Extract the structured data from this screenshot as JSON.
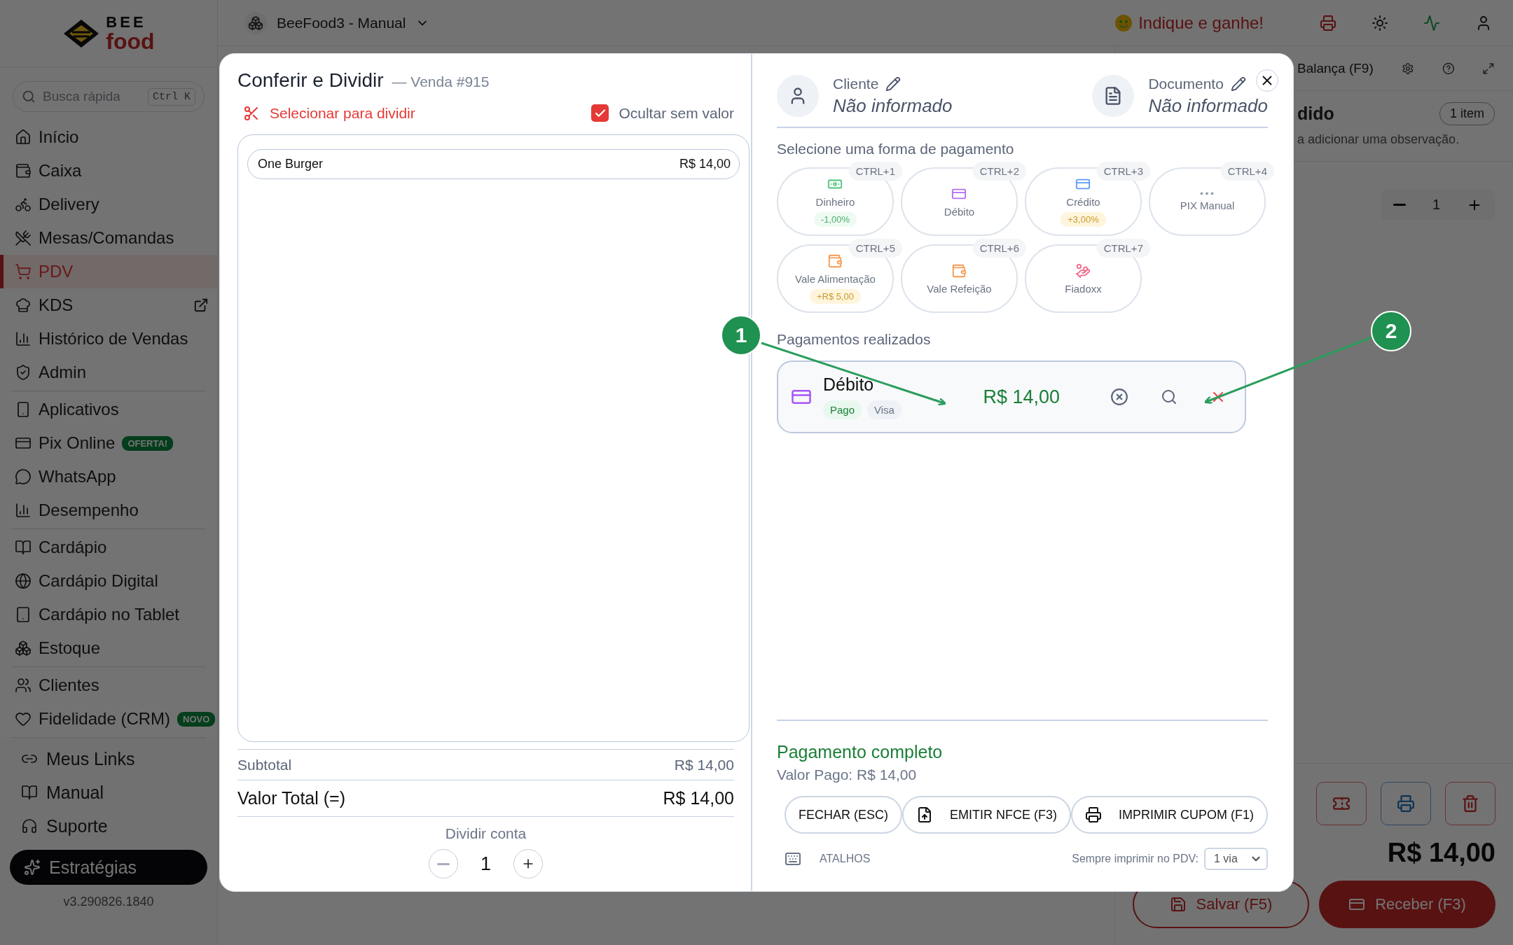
{
  "sidebar": {
    "logo": {
      "top": "BEE",
      "bottom": "food"
    },
    "search": {
      "placeholder": "Busca rápida",
      "shortcut": "Ctrl K"
    },
    "nav_groups": [
      [
        {
          "label": "Início",
          "selected": false
        },
        {
          "label": "Caixa",
          "selected": false
        },
        {
          "label": "Delivery",
          "selected": false
        },
        {
          "label": "Mesas/Comandas",
          "selected": false
        },
        {
          "label": "PDV",
          "selected": true
        },
        {
          "label": "KDS",
          "selected": false,
          "external": true
        },
        {
          "label": "Histórico de Vendas",
          "selected": false
        },
        {
          "label": "Admin",
          "selected": false
        }
      ],
      [
        {
          "label": "Aplicativos",
          "selected": false
        },
        {
          "label": "Pix Online",
          "selected": false,
          "badge": "OFERTA!"
        },
        {
          "label": "WhatsApp",
          "selected": false
        },
        {
          "label": "Desempenho",
          "selected": false
        }
      ],
      [
        {
          "label": "Cardápio",
          "selected": false
        },
        {
          "label": "Cardápio Digital",
          "selected": false
        },
        {
          "label": "Cardápio no Tablet",
          "selected": false
        },
        {
          "label": "Estoque",
          "selected": false
        }
      ],
      [
        {
          "label": "Clientes",
          "selected": false
        },
        {
          "label": "Fidelidade (CRM)",
          "selected": false,
          "badge": "NOVO"
        }
      ]
    ],
    "footer_items": [
      "Meus Links",
      "Manual",
      "Suporte"
    ],
    "cta": "Estratégias",
    "version": "v3.290826.1840"
  },
  "topbar": {
    "store": "BeeFood3 - Manual",
    "referral": "Indique e ganhe!"
  },
  "order_panel": {
    "scale_button": "Balança (F9)",
    "title": "dido",
    "item_count": "1 item",
    "note_hint": "a adicionar uma observação.",
    "quantity": "1",
    "total": "R$ 14,00",
    "save_button": "Salvar (F5)",
    "receive_button": "Receber (F3)"
  },
  "modal": {
    "title": "Conferir e Dividir",
    "subtitle": "— Venda #915",
    "split_select": "Selecionar para dividir",
    "hide_empty": {
      "label": "Ocultar sem valor",
      "checked": true
    },
    "items": [
      {
        "name": "One Burger",
        "price": "R$ 14,00"
      }
    ],
    "subtotal": {
      "label": "Subtotal",
      "value": "R$ 14,00"
    },
    "total": {
      "label": "Valor Total (=)",
      "value": "R$ 14,00"
    },
    "split": {
      "label": "Dividir conta",
      "count": "1"
    },
    "customer": {
      "label": "Cliente",
      "value": "Não informado"
    },
    "document": {
      "label": "Documento",
      "value": "Não informado"
    },
    "methods_title": "Selecione uma forma de pagamento",
    "methods": [
      {
        "label": "Dinheiro",
        "shortcut": "CTRL+1",
        "color": "#4cc47a",
        "adjustment": {
          "text": "-1,00%",
          "kind": "discount"
        }
      },
      {
        "label": "Débito",
        "shortcut": "CTRL+2",
        "color": "#b26cf0"
      },
      {
        "label": "Crédito",
        "shortcut": "CTRL+3",
        "color": "#5b9cf5",
        "adjustment": {
          "text": "+3,00%",
          "kind": "surcharge"
        }
      },
      {
        "label": "PIX Manual",
        "shortcut": "CTRL+4",
        "color": "#9aa3b2"
      },
      {
        "label": "Vale Alimentação",
        "shortcut": "CTRL+5",
        "color": "#f59a52",
        "adjustment": {
          "text": "+R$ 5,00",
          "kind": "surcharge"
        }
      },
      {
        "label": "Vale Refeição",
        "shortcut": "CTRL+6",
        "color": "#f59a52"
      },
      {
        "label": "Fiadoxx",
        "shortcut": "CTRL+7",
        "color": "#f06a8a"
      }
    ],
    "payments_title": "Pagamentos realizados",
    "payments": [
      {
        "method": "Débito",
        "status": "Pago",
        "brand": "Visa",
        "amount": "R$ 14,00"
      }
    ],
    "complete": "Pagamento completo",
    "paid": "Valor Pago: R$ 14,00",
    "actions": [
      "FECHAR (ESC)",
      "EMITIR NFCE (F3)",
      "IMPRIMIR CUPOM (F1)"
    ],
    "shortcuts": "ATALHOS",
    "print_label": "Sempre imprimir no PDV:",
    "print_copies": "1 via"
  },
  "annotations": [
    {
      "number": "1"
    },
    {
      "number": "2"
    }
  ]
}
